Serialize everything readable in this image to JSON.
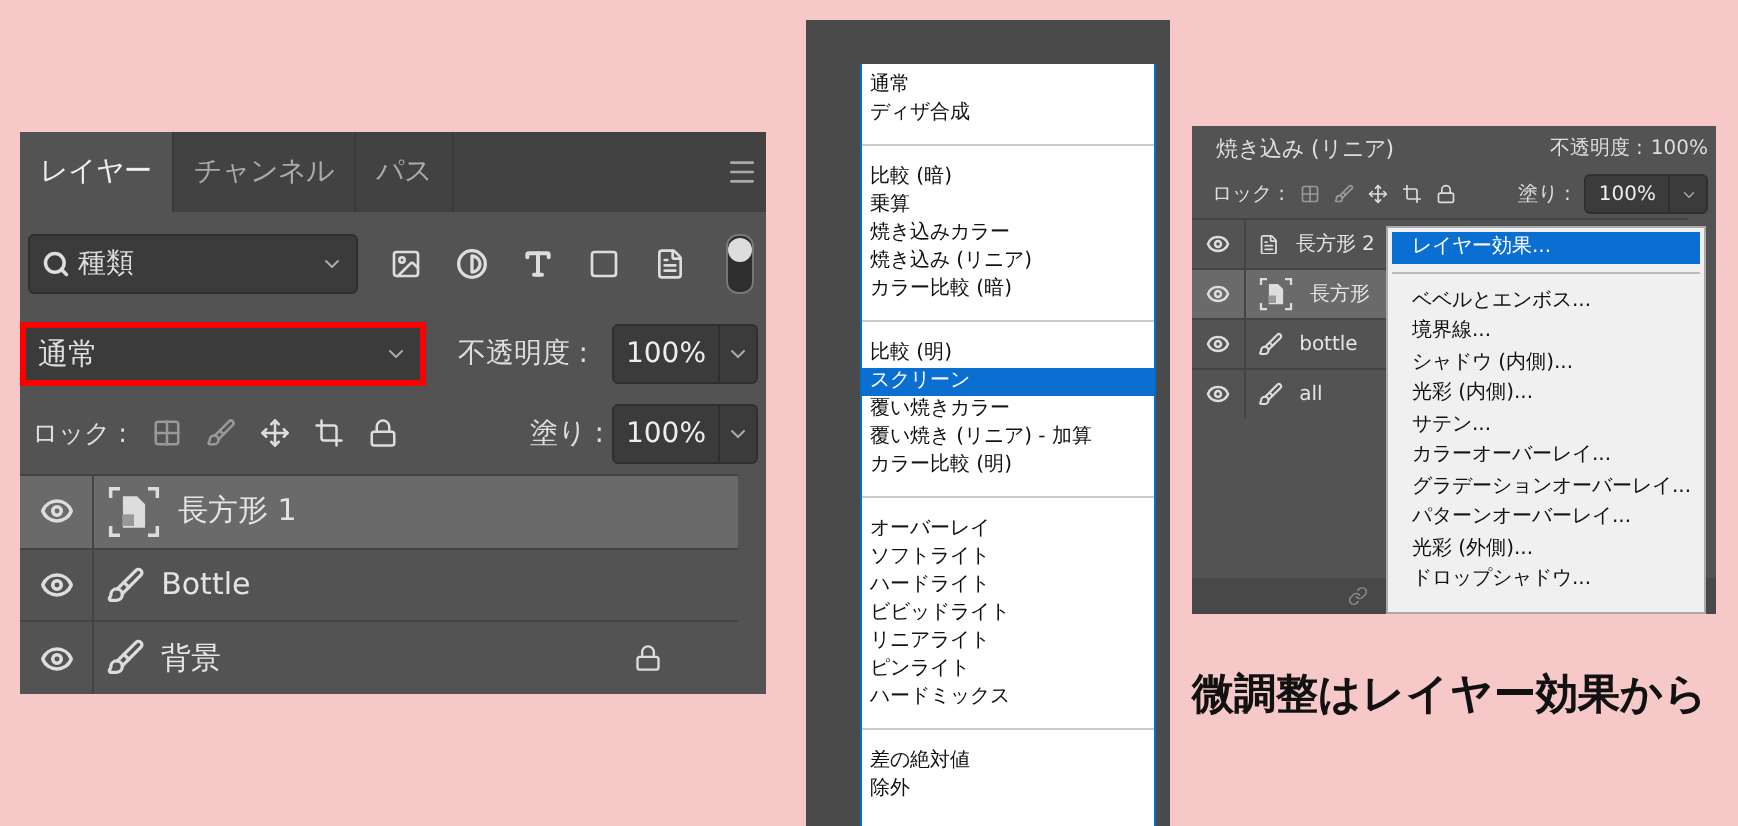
{
  "layers_panel": {
    "tabs": [
      {
        "label": "レイヤー",
        "selected": true
      },
      {
        "label": "チャンネル",
        "selected": false
      },
      {
        "label": "パス",
        "selected": false
      }
    ],
    "filter": {
      "value": "種類"
    },
    "blend_mode": {
      "value": "通常",
      "highlighted": true
    },
    "opacity": {
      "label": "不透明度 :",
      "value": "100%"
    },
    "lock": {
      "label": "ロック :"
    },
    "fill": {
      "label": "塗り :",
      "value": "100%"
    },
    "layers": [
      {
        "name": "長方形 1",
        "kind": "smart",
        "selected": true,
        "visible": true,
        "locked": false
      },
      {
        "name": "Bottle",
        "kind": "paint",
        "selected": false,
        "visible": true,
        "locked": false
      },
      {
        "name": "背景",
        "kind": "paint",
        "selected": false,
        "visible": true,
        "locked": true
      }
    ]
  },
  "blend_menu": {
    "sections": [
      [
        {
          "label": "通常",
          "selected": false
        },
        {
          "label": "ディザ合成",
          "selected": false
        }
      ],
      [
        {
          "label": "比較 (暗)",
          "selected": false
        },
        {
          "label": "乗算",
          "selected": false
        },
        {
          "label": "焼き込みカラー",
          "selected": false
        },
        {
          "label": "焼き込み (リニア)",
          "selected": false
        },
        {
          "label": "カラー比較 (暗)",
          "selected": false
        }
      ],
      [
        {
          "label": "比較 (明)",
          "selected": false
        },
        {
          "label": "スクリーン",
          "selected": true
        },
        {
          "label": "覆い焼きカラー",
          "selected": false
        },
        {
          "label": "覆い焼き (リニア) - 加算",
          "selected": false
        },
        {
          "label": "カラー比較 (明)",
          "selected": false
        }
      ],
      [
        {
          "label": "オーバーレイ",
          "selected": false
        },
        {
          "label": "ソフトライト",
          "selected": false
        },
        {
          "label": "ハードライト",
          "selected": false
        },
        {
          "label": "ビビッドライト",
          "selected": false
        },
        {
          "label": "リニアライト",
          "selected": false
        },
        {
          "label": "ピンライト",
          "selected": false
        },
        {
          "label": "ハードミックス",
          "selected": false
        }
      ],
      [
        {
          "label": "差の絶対値",
          "selected": false
        },
        {
          "label": "除外",
          "selected": false
        }
      ]
    ]
  },
  "effects_panel": {
    "blend_mode": {
      "value": "焼き込み (リニア)"
    },
    "opacity": {
      "label": "不透明度 :",
      "value": "100%"
    },
    "lock": {
      "label": "ロック :"
    },
    "fill": {
      "label": "塗り :",
      "value": "100%"
    },
    "layers": [
      {
        "name": "長方形 2",
        "kind": "shape",
        "selected": false,
        "visible": true
      },
      {
        "name": "長方形",
        "kind": "smart",
        "selected": true,
        "visible": true
      },
      {
        "name": "bottle",
        "kind": "paint",
        "selected": false,
        "visible": true
      },
      {
        "name": "all",
        "kind": "paint",
        "selected": false,
        "visible": true
      }
    ],
    "context_menu": {
      "sections": [
        [
          {
            "label": "レイヤー効果...",
            "selected": true
          }
        ],
        [
          {
            "label": "ベベルとエンボス...",
            "selected": false
          },
          {
            "label": "境界線...",
            "selected": false
          },
          {
            "label": "シャドウ (内側)...",
            "selected": false
          },
          {
            "label": "光彩 (内側)...",
            "selected": false
          },
          {
            "label": "サテン...",
            "selected": false
          },
          {
            "label": "カラーオーバーレイ...",
            "selected": false
          },
          {
            "label": "グラデーションオーバーレイ...",
            "selected": false
          },
          {
            "label": "パターンオーバーレイ...",
            "selected": false
          },
          {
            "label": "光彩 (外側)...",
            "selected": false
          },
          {
            "label": "ドロップシャドウ...",
            "selected": false
          }
        ]
      ]
    }
  },
  "caption": "微調整はレイヤー効果から"
}
